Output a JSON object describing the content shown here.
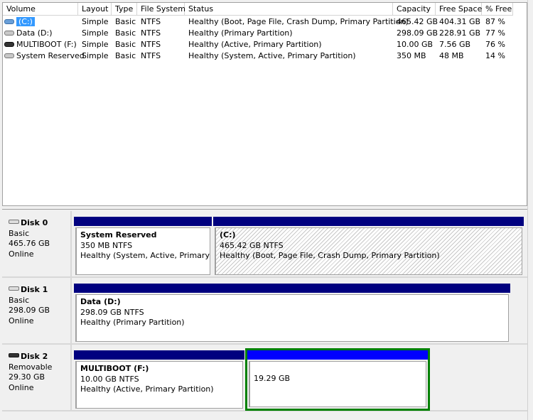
{
  "volume_table": {
    "columns": [
      "Volume",
      "Layout",
      "Type",
      "File System",
      "Status",
      "Capacity",
      "Free Space",
      "% Free"
    ],
    "rows": [
      {
        "volume": "(C:)",
        "icon": "drive-system-icon",
        "selected": true,
        "layout": "Simple",
        "type": "Basic",
        "fs": "NTFS",
        "status": "Healthy (Boot, Page File, Crash Dump, Primary Partition)",
        "capacity": "465.42 GB",
        "free": "404.31 GB",
        "pct": "87 %"
      },
      {
        "volume": "Data (D:)",
        "icon": "drive-icon",
        "layout": "Simple",
        "type": "Basic",
        "fs": "NTFS",
        "status": "Healthy (Primary Partition)",
        "capacity": "298.09 GB",
        "free": "228.91 GB",
        "pct": "77 %"
      },
      {
        "volume": "MULTIBOOT (F:)",
        "icon": "removable-drive-icon",
        "layout": "Simple",
        "type": "Basic",
        "fs": "NTFS",
        "status": "Healthy (Active, Primary Partition)",
        "capacity": "10.00 GB",
        "free": "7.56 GB",
        "pct": "76 %"
      },
      {
        "volume": "System Reserved",
        "icon": "drive-icon",
        "layout": "Simple",
        "type": "Basic",
        "fs": "NTFS",
        "status": "Healthy (System, Active, Primary Partition)",
        "capacity": "350 MB",
        "free": "48 MB",
        "pct": "14 %"
      }
    ]
  },
  "disks": [
    {
      "name": "Disk 0",
      "kind": "Basic",
      "size": "465.76 GB",
      "state": "Online",
      "partitions": [
        {
          "title": "System Reserved",
          "size": "350 MB NTFS",
          "status": "Healthy (System, Active, Primary Par"
        },
        {
          "title": " (C:)",
          "size": "465.42 GB NTFS",
          "status": "Healthy (Boot, Page File, Crash Dump, Primary Partition)"
        }
      ]
    },
    {
      "name": "Disk 1",
      "kind": "Basic",
      "size": "298.09 GB",
      "state": "Online",
      "partitions": [
        {
          "title": "Data  (D:)",
          "size": "298.09 GB NTFS",
          "status": "Healthy (Primary Partition)"
        }
      ]
    },
    {
      "name": "Disk 2",
      "kind": "Removable",
      "size": "29.30 GB",
      "state": "Online",
      "partitions": [
        {
          "title": "MULTIBOOT  (F:)",
          "size": "10.00 GB NTFS",
          "status": "Healthy (Active, Primary Partition)"
        },
        {
          "title": "",
          "size": "19.29 GB",
          "status": ""
        }
      ]
    }
  ],
  "colors": {
    "primary_bar": "#00007f",
    "unallocated_bar": "#0000ff",
    "selection_border": "#008000",
    "selection_highlight": "#3399ff"
  }
}
